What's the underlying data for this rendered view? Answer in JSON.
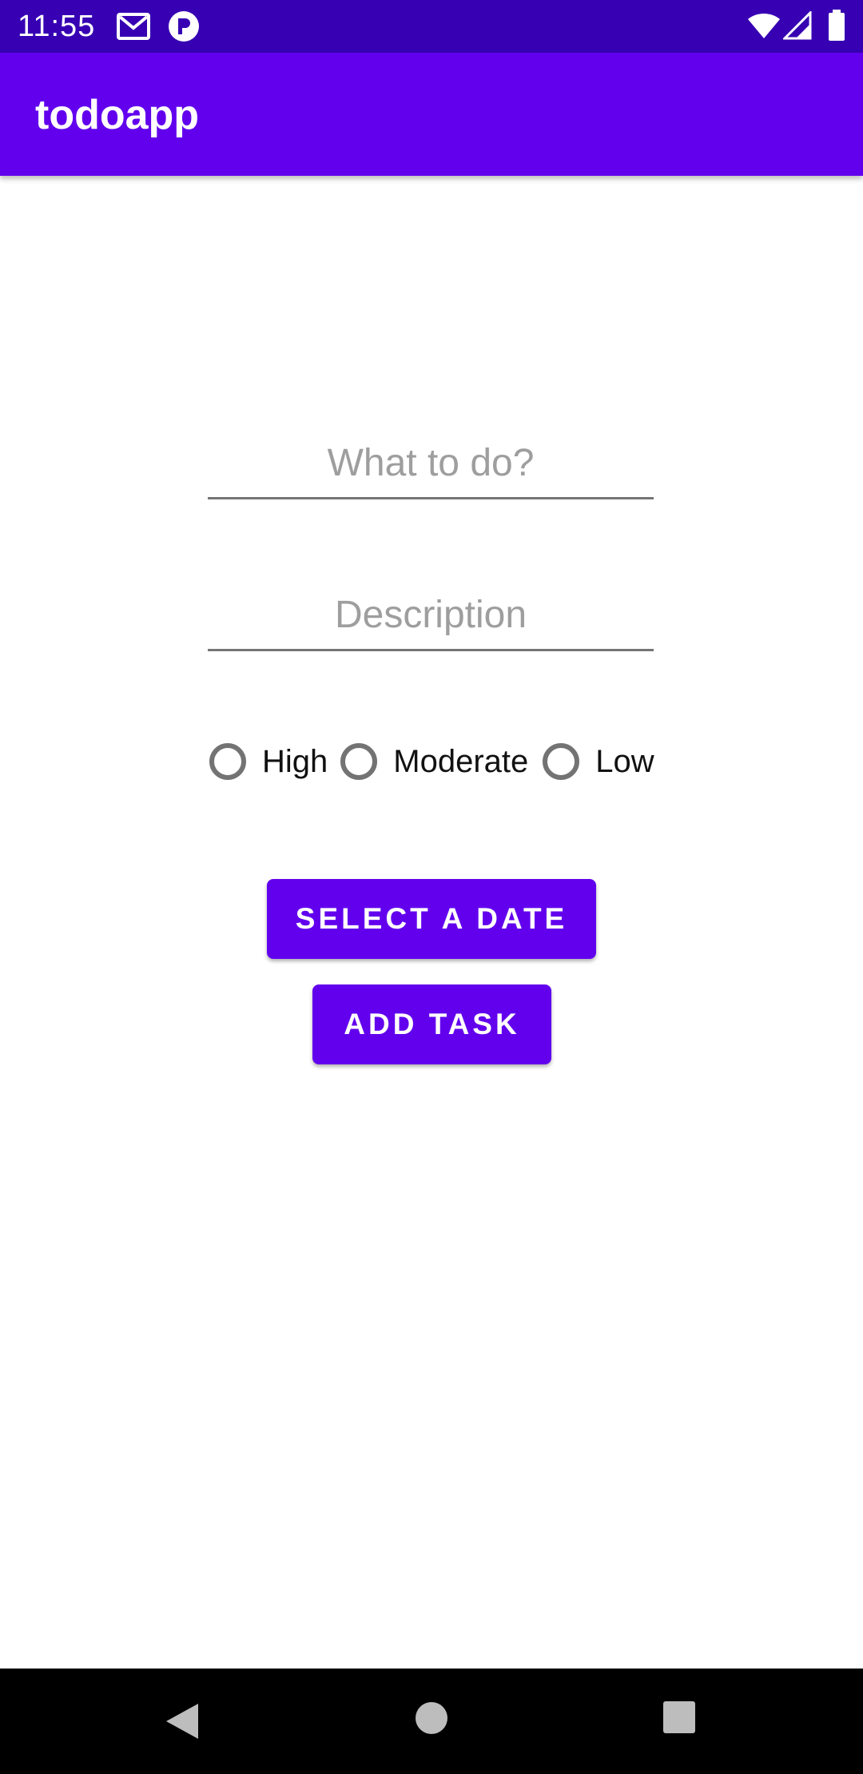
{
  "status_bar": {
    "time": "11:55",
    "icons": [
      "gmail-icon",
      "notification-app-icon",
      "wifi-icon",
      "signal-icon",
      "battery-icon"
    ]
  },
  "app_bar": {
    "title": "todoapp"
  },
  "form": {
    "task_placeholder": "What to do?",
    "description_placeholder": "Description",
    "priority_options": [
      "High",
      "Moderate",
      "Low"
    ],
    "select_date_label": "SELECT A DATE",
    "add_task_label": "ADD TASK"
  },
  "nav_bar": {
    "icons": [
      "back-icon",
      "home-icon",
      "recents-icon"
    ]
  },
  "colors": {
    "status_bar": "#3700b3",
    "primary": "#6200ee",
    "nav_bar": "#000000"
  }
}
